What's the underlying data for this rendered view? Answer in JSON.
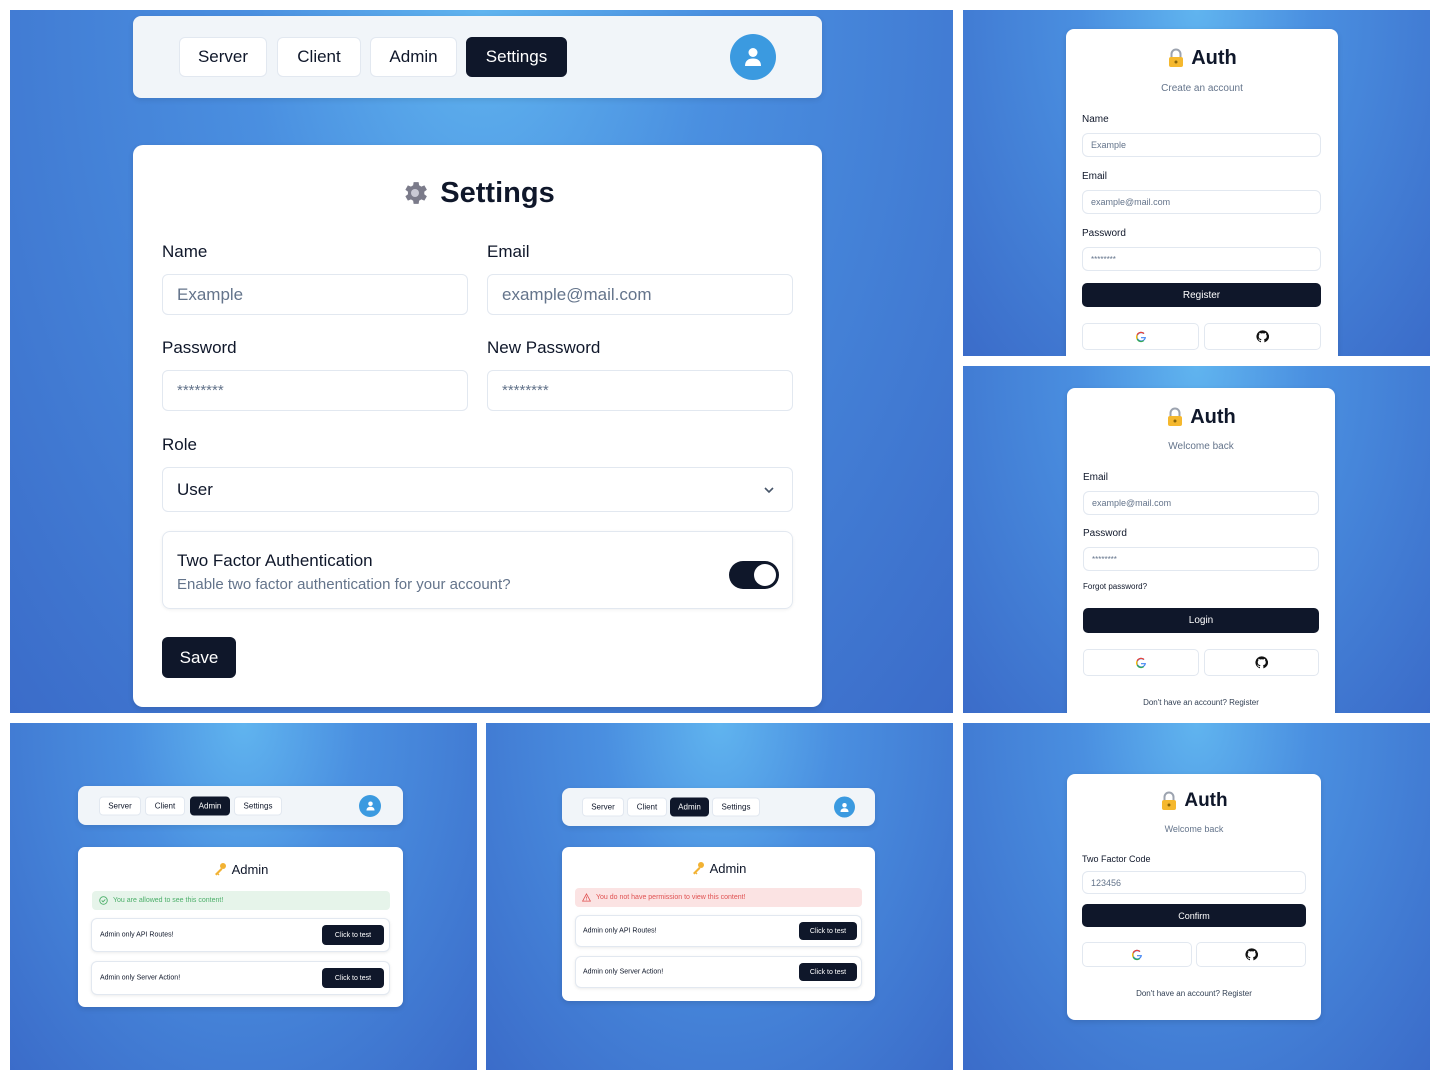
{
  "nav": {
    "server": "Server",
    "client": "Client",
    "admin": "Admin",
    "settings": "Settings"
  },
  "settings": {
    "title": "Settings",
    "name_label": "Name",
    "name_placeholder": "Example",
    "email_label": "Email",
    "email_placeholder": "example@mail.com",
    "password_label": "Password",
    "password_placeholder": "********",
    "new_password_label": "New Password",
    "new_password_placeholder": "********",
    "role_label": "Role",
    "role_value": "User",
    "two_factor_title": "Two Factor Authentication",
    "two_factor_desc": "Enable two factor authentication for your account?",
    "two_factor_enabled": true,
    "save_label": "Save"
  },
  "register": {
    "title": "Auth",
    "subtitle": "Create an account",
    "name_label": "Name",
    "name_placeholder": "Example",
    "email_label": "Email",
    "email_placeholder": "example@mail.com",
    "password_label": "Password",
    "password_placeholder": "********",
    "submit_label": "Register"
  },
  "login": {
    "title": "Auth",
    "subtitle": "Welcome back",
    "email_label": "Email",
    "email_placeholder": "example@mail.com",
    "password_label": "Password",
    "password_placeholder": "********",
    "forgot_label": "Forgot password?",
    "submit_label": "Login",
    "footer_label": "Don't have an account? Register"
  },
  "two_factor": {
    "title": "Auth",
    "subtitle": "Welcome back",
    "code_label": "Two Factor Code",
    "code_placeholder": "123456",
    "submit_label": "Confirm",
    "footer_label": "Don't have an account? Register"
  },
  "admin_allowed": {
    "title": "Admin",
    "notice": "You are allowed to see this content!",
    "rows": [
      {
        "label": "Admin only API Routes!",
        "button": "Click to test"
      },
      {
        "label": "Admin only Server Action!",
        "button": "Click to test"
      }
    ]
  },
  "admin_denied": {
    "title": "Admin",
    "notice": "You do not have permission to view this content!",
    "rows": [
      {
        "label": "Admin only API Routes!",
        "button": "Click to test"
      },
      {
        "label": "Admin only Server Action!",
        "button": "Click to test"
      }
    ]
  },
  "icons": {
    "settings": "gear-icon",
    "auth": "lock-icon",
    "admin": "key-icon",
    "user": "user-icon",
    "google": "google-icon",
    "github": "github-icon"
  },
  "colors": {
    "primary": "#0f172a",
    "accent": "#3b9ae0",
    "success_bg": "#e6f4ea",
    "success_text": "#4caf6a",
    "error_bg": "#fbe3e3",
    "error_text": "#e05252"
  }
}
